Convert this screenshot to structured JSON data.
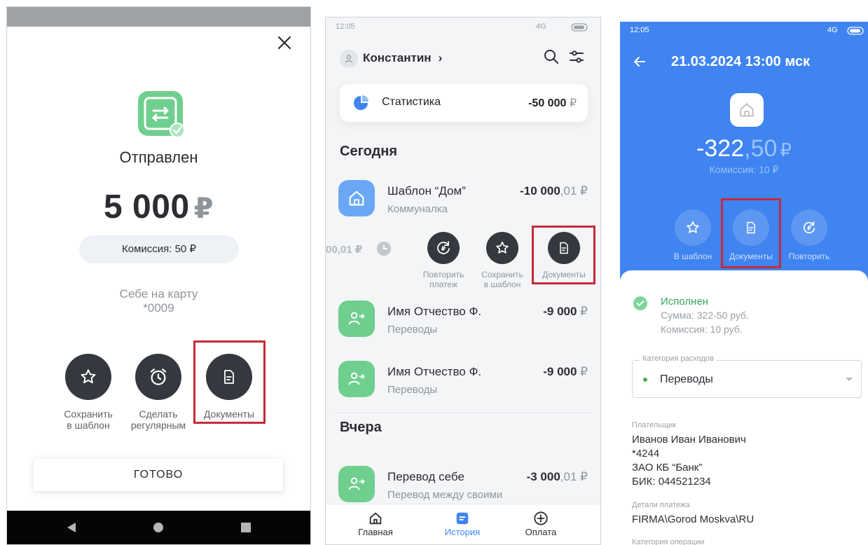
{
  "screen1": {
    "status_title": "Отправлен",
    "amount": "5 000",
    "currency": "₽",
    "fee": "Комиссия: 50 ₽",
    "dest_line1": "Себе на карту",
    "dest_line2": "*0009",
    "actions": [
      {
        "icon": "star-icon",
        "line1": "Сохранить",
        "line2": "в шаблон"
      },
      {
        "icon": "alarm-clock-icon",
        "line1": "Сделать",
        "line2": "регулярным"
      },
      {
        "icon": "document-icon",
        "line1": "Документы",
        "line2": ""
      }
    ],
    "done_label": "ГОТОВО"
  },
  "screen2": {
    "status_time": "12:05",
    "status_net": "4G",
    "user_name": "Константин",
    "stat_label": "Статистика",
    "stat_value": "-50 000",
    "stat_currency": "₽",
    "section_today": "Сегодня",
    "section_yesterday": "Вчера",
    "rows": [
      {
        "title": "Шаблон “Дом”",
        "sub": "Коммуналка",
        "amount_int": "-10 000",
        "amount_kop": ",01",
        "currency": "₽"
      },
      {
        "title": "Имя Отчество Ф.",
        "sub": "Переводы",
        "amount_int": "-9 000",
        "amount_kop": "",
        "currency": "₽"
      },
      {
        "title": "Имя Отчество Ф.",
        "sub": "Переводы",
        "amount_int": "-9 000",
        "amount_kop": "",
        "currency": "₽"
      },
      {
        "title": "Перевод себе",
        "sub": "Перевод между своими",
        "amount_int": "-3 000",
        "amount_kop": ",01",
        "currency": "₽"
      }
    ],
    "swiped_amount": "00,01 ₽",
    "quick_actions": [
      {
        "icon": "repeat-ruble-icon",
        "line1": "Повторить",
        "line2": "платеж"
      },
      {
        "icon": "star-icon",
        "line1": "Сохранить",
        "line2": "в шаблон"
      },
      {
        "icon": "document-icon",
        "line1": "Документы",
        "line2": ""
      }
    ],
    "tabs": [
      {
        "icon": "home-icon",
        "label": "Главная",
        "active": false
      },
      {
        "icon": "history-icon",
        "label": "История",
        "active": true
      },
      {
        "icon": "plus-circle-icon",
        "label": "Оплата",
        "active": false
      }
    ],
    "colors": {
      "active_tab": "#3f84f0",
      "accent_green": "#6fcf8e",
      "accent_blue": "#6aa8f5"
    }
  },
  "screen3": {
    "status_time": "12:05",
    "status_net": "4G",
    "date_title": "21.03.2024 13:00 мск",
    "amount_int": "-322",
    "amount_frac": ",50",
    "currency": "₽",
    "fee": "Комиссия: 10 ₽",
    "actions": [
      {
        "icon": "star-icon",
        "label": "В шаблон"
      },
      {
        "icon": "document-icon",
        "label": "Документы"
      },
      {
        "icon": "repeat-ruble-icon",
        "label": "Повторить"
      }
    ],
    "status": "Исполнен",
    "status_sum": "Сумма: 322-50 руб.",
    "status_fee": "Комиссия: 10 руб.",
    "category_legend": "Категория расходов",
    "category_value": "Переводы",
    "payer_label": "Плательщик",
    "payer_lines": [
      "Иванов Иван Иванович",
      "*4244",
      "ЗАО КБ “Банк”",
      "БИК: 044521234"
    ],
    "details_label": "Детали платежа",
    "details_value": "FIRMA\\Gorod Moskva\\RU",
    "operation_label": "Категория операции",
    "colors": {
      "header_bg": "#3f84f0",
      "status_green": "#3aa55a"
    }
  }
}
